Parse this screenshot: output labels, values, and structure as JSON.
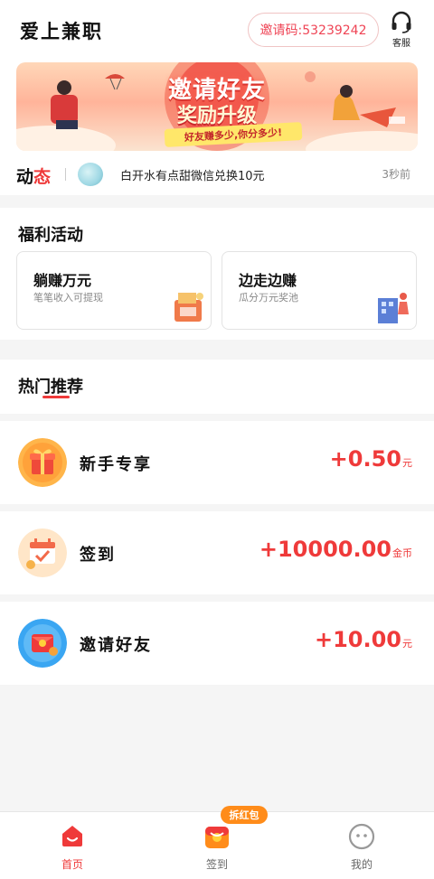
{
  "header": {
    "app_title": "爱上兼职",
    "invite_code": "邀请码:53239242",
    "customer_service_label": "客服"
  },
  "banner": {
    "title_line1": "邀请好友",
    "title_line2": "奖励升级",
    "ribbon_text": "好友赚多少,你分多少!"
  },
  "news": {
    "label_part1": "动",
    "label_part2": "态",
    "message": "白开水有点甜微信兑换10元",
    "time": "3秒前"
  },
  "welfare": {
    "section_title": "福利活动",
    "cards": [
      {
        "title": "躺赚万元",
        "subtitle": "笔笔收入可提现"
      },
      {
        "title": "边走边赚",
        "subtitle": "瓜分万元奖池"
      }
    ]
  },
  "hot": {
    "section_title": "热门推荐",
    "items": [
      {
        "name": "新手专享",
        "reward": "+0.50",
        "unit": "元"
      },
      {
        "name": "签到",
        "reward": "+10000.00",
        "unit": "金币"
      },
      {
        "name": "邀请好友",
        "reward": "+10.00",
        "unit": "元"
      }
    ]
  },
  "tabbar": {
    "tabs": [
      {
        "label": "首页",
        "active": true
      },
      {
        "label": "签到",
        "active": false
      },
      {
        "label": "我的",
        "active": false
      }
    ],
    "badge": "拆红包"
  },
  "colors": {
    "accent": "#ef3a3a",
    "orange": "#ff8c1a",
    "background": "#f5f5f5"
  }
}
